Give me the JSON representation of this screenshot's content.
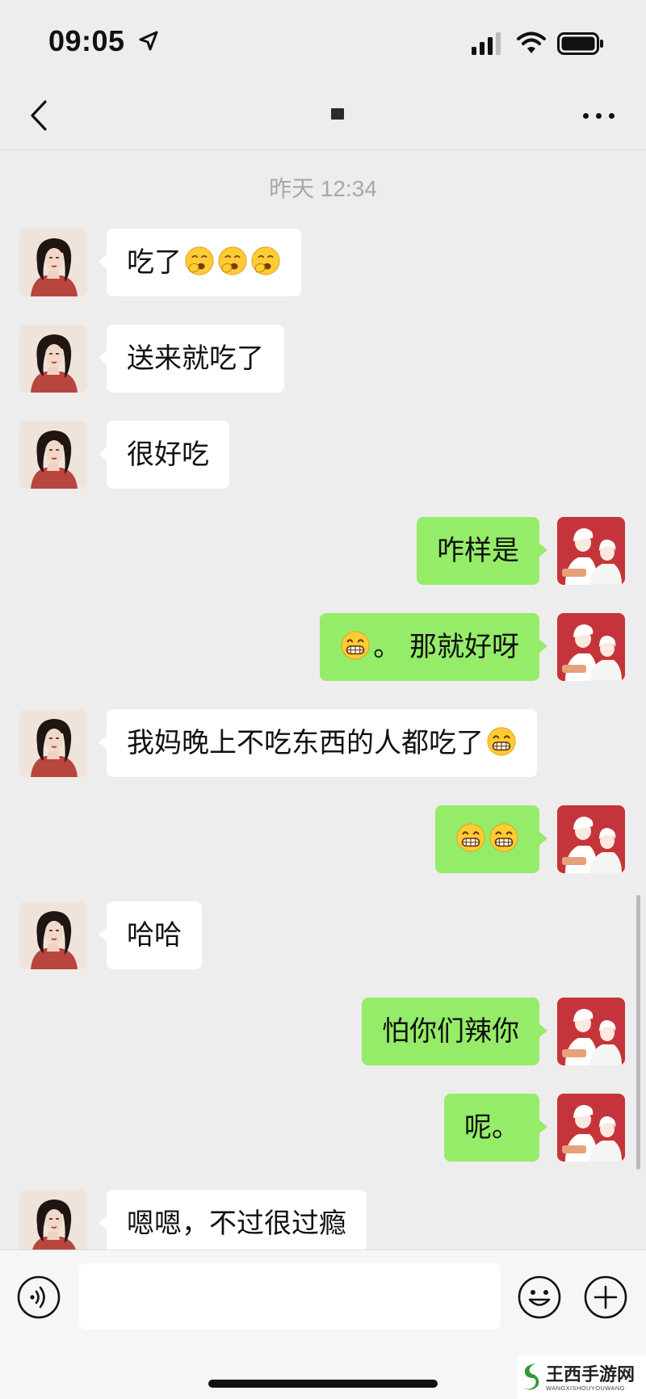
{
  "status_bar": {
    "time": "09:05",
    "icons": [
      "location-arrow-icon",
      "cellular-signal-icon",
      "wifi-icon",
      "battery-icon"
    ]
  },
  "nav": {
    "back_icon": "chevron-left-icon",
    "title": "",
    "more_icon": "more-dots-icon"
  },
  "chat": {
    "timestamp": "昨天 12:34",
    "messages": [
      {
        "side": "left",
        "text": "吃了",
        "emoji": [
          "yawning-face",
          "yawning-face",
          "yawning-face"
        ]
      },
      {
        "side": "left",
        "text": "送来就吃了",
        "emoji": []
      },
      {
        "side": "left",
        "text": "很好吃",
        "emoji": []
      },
      {
        "side": "right",
        "text": "咋样是",
        "emoji": []
      },
      {
        "side": "right",
        "text": "。 那就好呀",
        "emoji": [
          "grinning-face"
        ]
      },
      {
        "side": "left",
        "text": "我妈晚上不吃东西的人都吃了",
        "emoji": [
          "grinning-face"
        ]
      },
      {
        "side": "right",
        "text": "",
        "emoji": [
          "grinning-face",
          "grinning-face"
        ]
      },
      {
        "side": "left",
        "text": "哈哈",
        "emoji": []
      },
      {
        "side": "right",
        "text": "怕你们辣你",
        "emoji": []
      },
      {
        "side": "right",
        "text": "呢。",
        "emoji": []
      },
      {
        "side": "left",
        "text": "嗯嗯，不过很过瘾",
        "emoji": []
      }
    ]
  },
  "input_bar": {
    "voice_icon": "voice-icon",
    "input_value": "",
    "emoji_icon": "emoji-smile-icon",
    "plus_icon": "plus-circle-icon"
  },
  "watermark": {
    "title": "王西手游网",
    "subtitle": "WANGXISHOUYOUWANG"
  },
  "colors": {
    "background": "#ededed",
    "bubble_self": "#95ec69",
    "bubble_other": "#ffffff"
  }
}
